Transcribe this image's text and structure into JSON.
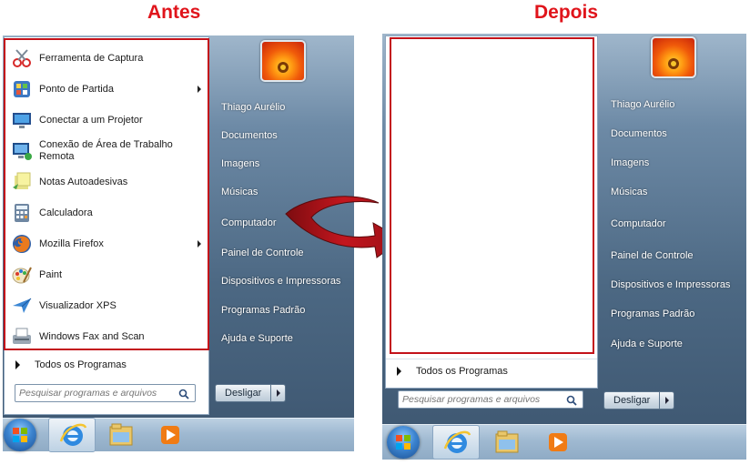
{
  "captions": {
    "before": "Antes",
    "after": "Depois"
  },
  "menu": {
    "programs": [
      {
        "label": "Ferramenta de Captura",
        "icon": "snipping-tool-icon",
        "submenu": false
      },
      {
        "label": "Ponto de Partida",
        "icon": "getting-started-icon",
        "submenu": true
      },
      {
        "label": "Conectar a um Projetor",
        "icon": "projector-icon",
        "submenu": false
      },
      {
        "label": "Conexão de Área de Trabalho Remota",
        "icon": "remote-desktop-icon",
        "submenu": false
      },
      {
        "label": "Notas Autoadesivas",
        "icon": "sticky-notes-icon",
        "submenu": false
      },
      {
        "label": "Calculadora",
        "icon": "calculator-icon",
        "submenu": false
      },
      {
        "label": "Mozilla Firefox",
        "icon": "firefox-icon",
        "submenu": true
      },
      {
        "label": "Paint",
        "icon": "paint-icon",
        "submenu": false
      },
      {
        "label": "Visualizador XPS",
        "icon": "xps-viewer-icon",
        "submenu": false
      },
      {
        "label": "Windows Fax and Scan",
        "icon": "fax-scan-icon",
        "submenu": false
      }
    ],
    "all_programs": "Todos os Programas",
    "search_placeholder": "Pesquisar programas e arquivos",
    "right_links": [
      "Thiago Aurélio",
      "Documentos",
      "Imagens",
      "Músicas",
      "Computador",
      "Painel de Controle",
      "Dispositivos e Impressoras",
      "Programas Padrão",
      "Ajuda e Suporte"
    ],
    "shutdown": "Desligar"
  },
  "taskbar": {
    "items": [
      "start-orb-icon",
      "internet-explorer-icon",
      "windows-explorer-icon",
      "media-player-icon"
    ]
  },
  "colors": {
    "highlight": "#c3121a",
    "arrow": "#b3141c"
  }
}
